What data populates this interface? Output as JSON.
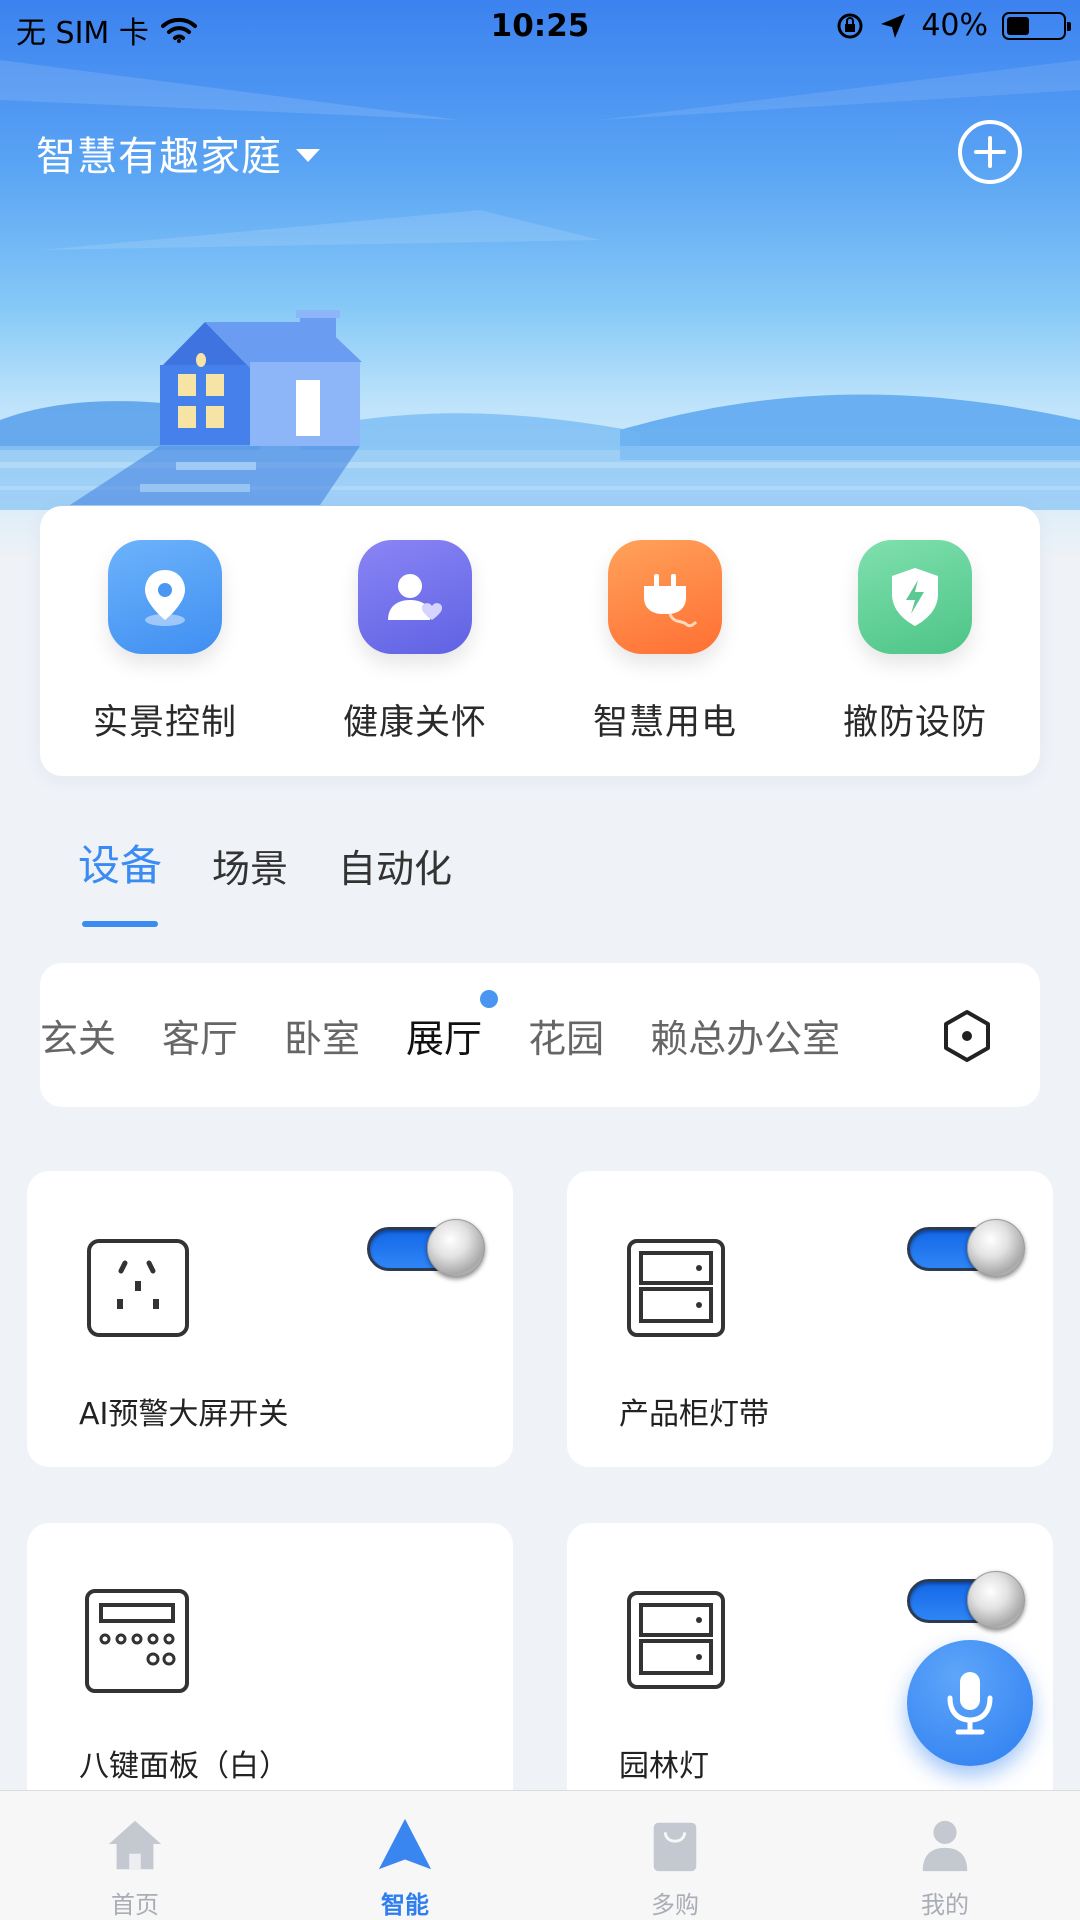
{
  "status_bar": {
    "carrier": "无 SIM 卡",
    "time": "10:25",
    "battery": "40%",
    "battery_level": 0.4,
    "icons": [
      "wifi-icon",
      "orientation-lock-icon",
      "location-arrow-icon",
      "battery-icon"
    ]
  },
  "header": {
    "home_name": "智慧有趣家庭",
    "add_icon": "plus-circle-icon"
  },
  "quick_actions": [
    {
      "label": "实景控制",
      "icon": "location-pin-icon",
      "color": "#4a9cf5"
    },
    {
      "label": "健康关怀",
      "icon": "person-heart-icon",
      "color": "#6b6fe8"
    },
    {
      "label": "智慧用电",
      "icon": "plug-icon",
      "color": "#ff8a3d"
    },
    {
      "label": "撤防设防",
      "icon": "shield-bolt-icon",
      "color": "#5ccf95"
    }
  ],
  "tabs": [
    {
      "label": "设备",
      "active": true
    },
    {
      "label": "场景",
      "active": false
    },
    {
      "label": "自动化",
      "active": false
    }
  ],
  "rooms": [
    {
      "label": "玄关",
      "active": false
    },
    {
      "label": "客厅",
      "active": false
    },
    {
      "label": "卧室",
      "active": false
    },
    {
      "label": "展厅",
      "active": true
    },
    {
      "label": "花园",
      "active": false
    },
    {
      "label": "赖总办公室",
      "active": false
    }
  ],
  "devices": [
    {
      "name": "AI预警大屏开关",
      "icon": "socket-icon",
      "has_toggle": true,
      "on": true
    },
    {
      "name": "产品柜灯带",
      "icon": "light-strip-icon",
      "has_toggle": true,
      "on": true
    },
    {
      "name": "八键面板（白）",
      "icon": "keypad-panel-icon",
      "has_toggle": false
    },
    {
      "name": "园林灯",
      "icon": "light-strip-icon",
      "has_toggle": true,
      "on": true
    }
  ],
  "bottom_nav": [
    {
      "label": "首页",
      "icon": "home-icon",
      "active": false
    },
    {
      "label": "智能",
      "icon": "navigation-arrow-icon",
      "active": true
    },
    {
      "label": "多购",
      "icon": "shopping-bag-icon",
      "active": false
    },
    {
      "label": "我的",
      "icon": "user-icon",
      "active": false
    }
  ],
  "colors": {
    "accent": "#3b8cf2",
    "background": "#eff2f7",
    "toggle_on": "#1f72ee"
  }
}
